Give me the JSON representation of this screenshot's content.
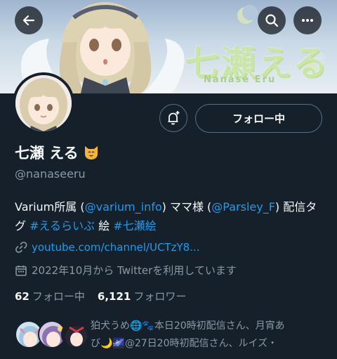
{
  "banner": {
    "title": "七瀬える",
    "subtitle": "Nanase Eru"
  },
  "header": {
    "back_icon": "back-arrow-icon",
    "search_icon": "search-icon",
    "more_icon": "more-icon"
  },
  "profile": {
    "display_name": "七瀬 える",
    "name_emoji": "cat-face-icon",
    "handle": "@nanaseeru",
    "follow_button_label": "フォロー中",
    "bio": {
      "part1": "Varium所属 (",
      "mention1": "@varium_info",
      "part2": ") ママ様 (",
      "mention2": "@Parsley_F",
      "part3": ") 配信タグ ",
      "tag1": "#えるらいぶ",
      "part4": " 絵 ",
      "tag2": "#七瀬絵"
    },
    "url": "youtube.com/channel/UCTzY8...",
    "joined": "2022年10月から Twitterを利用しています",
    "following_count": "62",
    "following_label": "フォロー中",
    "followers_count": "6,121",
    "followers_label": "フォロワー"
  },
  "mutuals": {
    "text_line1": "狛犬うめ🌐🐾本日20時初配信さん、月宵あ",
    "text_line2": "び🌙🌌@27日20時初配信さん、ルイズ・"
  },
  "colors": {
    "background": "#15202b",
    "accent": "#1d9bf0",
    "secondary_text": "#8b98a5"
  }
}
